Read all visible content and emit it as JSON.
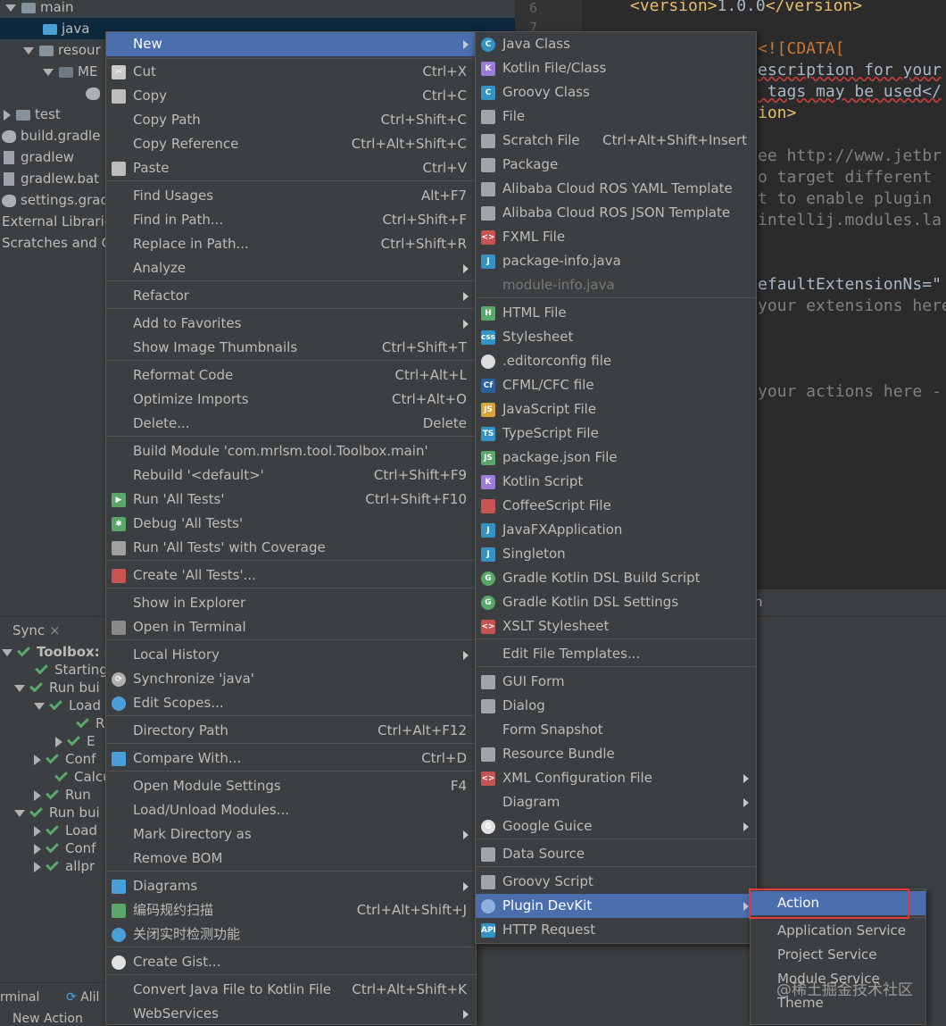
{
  "tree": {
    "items": [
      {
        "label": "main",
        "icon": "folder-icon"
      },
      {
        "label": "java",
        "icon": "source-folder-icon"
      },
      {
        "label": "resour",
        "icon": "resources-folder-icon"
      },
      {
        "label": "ME",
        "icon": "folder-icon"
      },
      {
        "label": "test",
        "icon": "folder-icon"
      },
      {
        "label": "build.gradle",
        "icon": "gradle-icon"
      },
      {
        "label": "gradlew",
        "icon": "file-icon"
      },
      {
        "label": "gradlew.bat",
        "icon": "file-icon"
      },
      {
        "label": "settings.grad",
        "icon": "gradle-icon"
      },
      {
        "label": "External Librarie",
        "icon": ""
      },
      {
        "label": "Scratches and C",
        "icon": ""
      }
    ]
  },
  "editor": {
    "line_numbers": [
      "6",
      "7"
    ],
    "lines": [
      {
        "tag_open": "<version>",
        "text": "1.0.0",
        "tag_close": "</version>"
      },
      {
        "text": "<![CDATA["
      },
      {
        "text": "escription for your"
      },
      {
        "text": " tags may be used</"
      },
      {
        "text": "ion>"
      },
      {
        "text": "ee http://www.jetbr"
      },
      {
        "text": "o target different"
      },
      {
        "text": "t to enable plugin"
      },
      {
        "text": "intellij.modules.la"
      },
      {
        "text": "efaultExtensionNs=\""
      },
      {
        "text": "your extensions here"
      },
      {
        "text": "your actions here -"
      }
    ],
    "fragment_h": "n"
  },
  "sync": {
    "tab_label": "Sync",
    "tab_close": "×",
    "rows": [
      "Toolbox: sy",
      "Starting",
      "Run bui",
      "Load",
      "R",
      "E",
      "Conf",
      "Calcu",
      "Run",
      "Run bui",
      "Load",
      "Conf",
      "allpr"
    ]
  },
  "status": {
    "terminal": "rminal",
    "alibaba": "Alil",
    "new_action": "New Action"
  },
  "context_menu": {
    "items": [
      {
        "label": "New",
        "shortcut": "",
        "submenu": true,
        "icon": ""
      },
      {
        "label": "Cut",
        "shortcut": "Ctrl+X",
        "icon": "scissors-icon"
      },
      {
        "label": "Copy",
        "shortcut": "Ctrl+C",
        "icon": "copy-icon"
      },
      {
        "label": "Copy Path",
        "shortcut": "Ctrl+Shift+C",
        "icon": ""
      },
      {
        "label": "Copy Reference",
        "shortcut": "Ctrl+Alt+Shift+C",
        "icon": ""
      },
      {
        "label": "Paste",
        "shortcut": "Ctrl+V",
        "icon": "paste-icon"
      },
      {
        "label": "Find Usages",
        "shortcut": "Alt+F7",
        "icon": ""
      },
      {
        "label": "Find in Path...",
        "shortcut": "Ctrl+Shift+F",
        "icon": ""
      },
      {
        "label": "Replace in Path...",
        "shortcut": "Ctrl+Shift+R",
        "icon": ""
      },
      {
        "label": "Analyze",
        "shortcut": "",
        "submenu": true,
        "icon": ""
      },
      {
        "label": "Refactor",
        "shortcut": "",
        "submenu": true,
        "icon": ""
      },
      {
        "label": "Add to Favorites",
        "shortcut": "",
        "submenu": true,
        "icon": ""
      },
      {
        "label": "Show Image Thumbnails",
        "shortcut": "Ctrl+Shift+T",
        "icon": ""
      },
      {
        "label": "Reformat Code",
        "shortcut": "Ctrl+Alt+L",
        "icon": ""
      },
      {
        "label": "Optimize Imports",
        "shortcut": "Ctrl+Alt+O",
        "icon": ""
      },
      {
        "label": "Delete...",
        "shortcut": "Delete",
        "icon": ""
      },
      {
        "label": "Build Module 'com.mrlsm.tool.Toolbox.main'",
        "shortcut": "",
        "icon": ""
      },
      {
        "label": "Rebuild '<default>'",
        "shortcut": "Ctrl+Shift+F9",
        "icon": ""
      },
      {
        "label": "Run 'All Tests'",
        "shortcut": "Ctrl+Shift+F10",
        "icon": "run-icon"
      },
      {
        "label": "Debug 'All Tests'",
        "shortcut": "",
        "icon": "debug-icon"
      },
      {
        "label": "Run 'All Tests' with Coverage",
        "shortcut": "",
        "icon": "coverage-icon"
      },
      {
        "label": "Create 'All Tests'...",
        "shortcut": "",
        "icon": "create-test-icon"
      },
      {
        "label": "Show in Explorer",
        "shortcut": "",
        "icon": ""
      },
      {
        "label": "Open in Terminal",
        "shortcut": "",
        "icon": "terminal-icon"
      },
      {
        "label": "Local History",
        "shortcut": "",
        "submenu": true,
        "icon": ""
      },
      {
        "label": "Synchronize 'java'",
        "shortcut": "",
        "icon": "sync-icon"
      },
      {
        "label": "Edit Scopes...",
        "shortcut": "",
        "icon": "scope-icon"
      },
      {
        "label": "Directory Path",
        "shortcut": "Ctrl+Alt+F12",
        "icon": ""
      },
      {
        "label": "Compare With...",
        "shortcut": "Ctrl+D",
        "icon": "compare-icon"
      },
      {
        "label": "Open Module Settings",
        "shortcut": "F4",
        "icon": ""
      },
      {
        "label": "Load/Unload Modules...",
        "shortcut": "",
        "icon": ""
      },
      {
        "label": "Mark Directory as",
        "shortcut": "",
        "submenu": true,
        "icon": ""
      },
      {
        "label": "Remove BOM",
        "shortcut": "",
        "icon": ""
      },
      {
        "label": "Diagrams",
        "shortcut": "",
        "submenu": true,
        "icon": "diagram-icon"
      },
      {
        "label": "编码规约扫描",
        "shortcut": "Ctrl+Alt+Shift+J",
        "icon": "code-scan-icon"
      },
      {
        "label": "关闭实时检测功能",
        "shortcut": "",
        "icon": "disable-icon"
      },
      {
        "label": "Create Gist...",
        "shortcut": "",
        "icon": "github-icon"
      },
      {
        "label": "Convert Java File to Kotlin File",
        "shortcut": "Ctrl+Alt+Shift+K",
        "icon": ""
      },
      {
        "label": "WebServices",
        "shortcut": "",
        "submenu": true,
        "icon": ""
      }
    ]
  },
  "new_menu": {
    "items": [
      {
        "label": "Java Class",
        "icon": "java-class-icon",
        "badge": "C"
      },
      {
        "label": "Kotlin File/Class",
        "icon": "kotlin-file-icon",
        "badge": "K"
      },
      {
        "label": "Groovy Class",
        "icon": "groovy-class-icon",
        "badge": "C"
      },
      {
        "label": "File",
        "icon": "file-icon",
        "badge": ""
      },
      {
        "label": "Scratch File",
        "shortcut": "Ctrl+Alt+Shift+Insert",
        "icon": "scratch-file-icon",
        "badge": ""
      },
      {
        "label": "Package",
        "icon": "package-icon",
        "badge": ""
      },
      {
        "label": "Alibaba Cloud ROS YAML Template",
        "icon": "ros-yaml-icon",
        "badge": ""
      },
      {
        "label": "Alibaba Cloud ROS JSON Template",
        "icon": "ros-json-icon",
        "badge": ""
      },
      {
        "label": "FXML File",
        "icon": "fxml-icon",
        "badge": "<>"
      },
      {
        "label": "package-info.java",
        "icon": "package-info-icon",
        "badge": "J"
      },
      {
        "label": "module-info.java",
        "icon": "module-info-icon",
        "badge": "",
        "disabled": true
      },
      {
        "label": "HTML File",
        "icon": "html-icon",
        "badge": "H"
      },
      {
        "label": "Stylesheet",
        "icon": "css-icon",
        "badge": "css"
      },
      {
        "label": ".editorconfig file",
        "icon": "editorconfig-icon",
        "badge": ""
      },
      {
        "label": "CFML/CFC file",
        "icon": "cfml-icon",
        "badge": "Cf"
      },
      {
        "label": "JavaScript File",
        "icon": "javascript-icon",
        "badge": "JS"
      },
      {
        "label": "TypeScript File",
        "icon": "typescript-icon",
        "badge": "TS"
      },
      {
        "label": "package.json File",
        "icon": "nodejs-icon",
        "badge": "JS"
      },
      {
        "label": "Kotlin Script",
        "icon": "kotlin-script-icon",
        "badge": "K"
      },
      {
        "label": "CoffeeScript File",
        "icon": "coffeescript-icon",
        "badge": ""
      },
      {
        "label": "JavaFXApplication",
        "icon": "javafx-icon",
        "badge": "J"
      },
      {
        "label": "Singleton",
        "icon": "singleton-icon",
        "badge": "J"
      },
      {
        "label": "Gradle Kotlin DSL Build Script",
        "icon": "gradle-kotlin-icon",
        "badge": "G"
      },
      {
        "label": "Gradle Kotlin DSL Settings",
        "icon": "gradle-kotlin-icon",
        "badge": "G"
      },
      {
        "label": "XSLT Stylesheet",
        "icon": "xslt-icon",
        "badge": "<>"
      },
      {
        "label": "Edit File Templates...",
        "icon": "",
        "badge": ""
      },
      {
        "label": "GUI Form",
        "icon": "gui-form-icon",
        "badge": ""
      },
      {
        "label": "Dialog",
        "icon": "dialog-icon",
        "badge": ""
      },
      {
        "label": "Form Snapshot",
        "icon": "",
        "badge": ""
      },
      {
        "label": "Resource Bundle",
        "icon": "resource-bundle-icon",
        "badge": ""
      },
      {
        "label": "XML Configuration File",
        "icon": "xml-icon",
        "badge": "<>",
        "submenu": true
      },
      {
        "label": "Diagram",
        "icon": "",
        "badge": "",
        "submenu": true
      },
      {
        "label": "Google Guice",
        "icon": "google-icon",
        "badge": "G",
        "submenu": true
      },
      {
        "label": "Data Source",
        "icon": "database-icon",
        "badge": ""
      },
      {
        "label": "Groovy Script",
        "icon": "groovy-script-icon",
        "badge": ""
      },
      {
        "label": "Plugin DevKit",
        "icon": "plugin-icon",
        "badge": "",
        "submenu": true
      },
      {
        "label": "HTTP Request",
        "icon": "api-icon",
        "badge": "API"
      }
    ]
  },
  "devkit_menu": {
    "items": [
      "Action",
      "Application Service",
      "Project Service",
      "Module Service",
      "Theme"
    ]
  },
  "watermark": "@稀土掘金技术社区",
  "colors": {
    "menu_bg": "#3c3f41",
    "highlight": "#4b6eaf",
    "editor_bg": "#2b2b2b",
    "red_box": "#e23b3b",
    "check_green": "#59a869",
    "xml_tag": "#e8bf6a"
  }
}
